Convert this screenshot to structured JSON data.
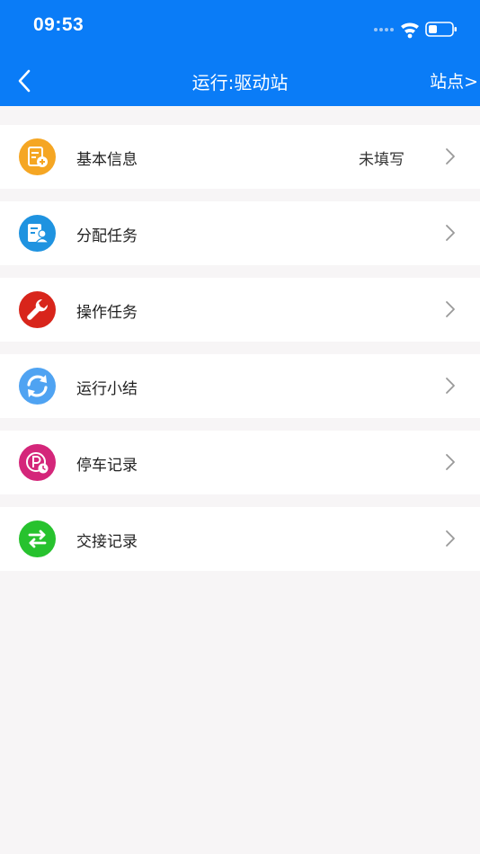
{
  "status_bar": {
    "time": "09:53",
    "icons": [
      "signal-dots-icon",
      "wifi-icon",
      "battery-icon"
    ]
  },
  "nav": {
    "back_icon": "chevron-left-icon",
    "title": "运行:驱动站",
    "right_label": "站点>"
  },
  "menu": {
    "items": [
      {
        "label": "基本信息",
        "value": "未填写",
        "icon": "document-add-icon",
        "color": "#f5a623"
      },
      {
        "label": "分配任务",
        "value": "",
        "icon": "assign-person-icon",
        "color": "#1f93e0"
      },
      {
        "label": "操作任务",
        "value": "",
        "icon": "wrench-icon",
        "color": "#d8251b"
      },
      {
        "label": "运行小结",
        "value": "",
        "icon": "refresh-cycle-icon",
        "color": "#4fa3f2"
      },
      {
        "label": "停车记录",
        "value": "",
        "icon": "parking-clock-icon",
        "color": "#d4267a"
      },
      {
        "label": "交接记录",
        "value": "",
        "icon": "swap-arrows-icon",
        "color": "#27c22e"
      }
    ]
  },
  "colors": {
    "header": "#0a7cf7",
    "background": "#f7f5f6",
    "row": "#ffffff",
    "chevron": "#999999"
  }
}
